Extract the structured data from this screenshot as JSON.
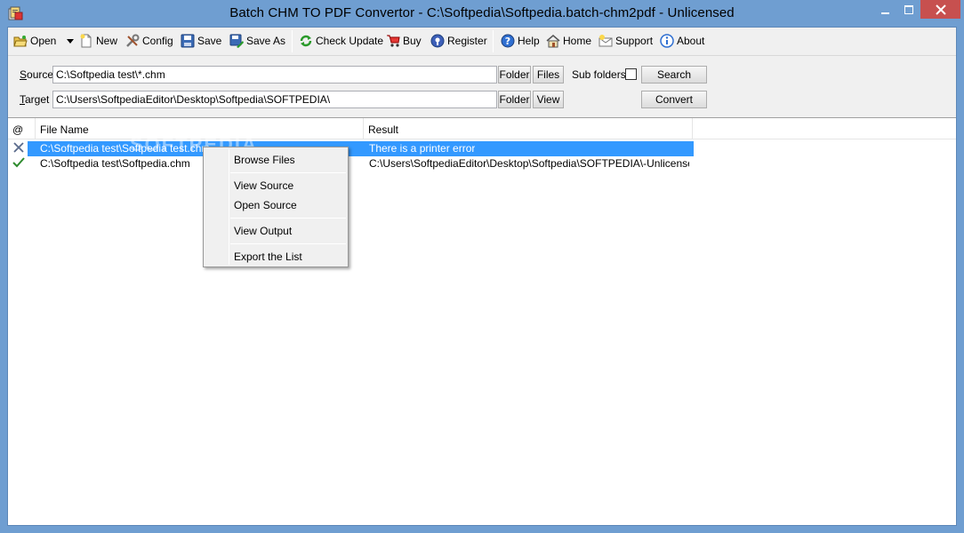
{
  "window": {
    "title": "Batch CHM TO PDF Convertor - C:\\Softpedia\\Softpedia.batch-chm2pdf - Unlicensed"
  },
  "toolbar": {
    "open": "Open",
    "new": "New",
    "config": "Config",
    "save": "Save",
    "save_as": "Save As",
    "check_update": "Check Update",
    "buy": "Buy",
    "register": "Register",
    "help": "Help",
    "home": "Home",
    "support": "Support",
    "about": "About"
  },
  "form": {
    "source_label_key": "S",
    "source_label_rest": "ource",
    "source_value": "C:\\Softpedia test\\*.chm",
    "target_label_key": "T",
    "target_label_rest": "arget",
    "target_value": "C:\\Users\\SoftpediaEditor\\Desktop\\Softpedia\\SOFTPEDIA\\",
    "folder_btn": "Folder",
    "files_btn": "Files",
    "view_btn": "View",
    "subfolders_label": "Sub folders",
    "subfolders_checked": false,
    "search_btn": "Search",
    "convert_btn": "Convert"
  },
  "list": {
    "columns": [
      "@",
      "File Name",
      "Result"
    ],
    "rows": [
      {
        "status_icon": "error-x-icon",
        "file": "C:\\Softpedia test\\Softpedia test.chm",
        "result": "There is a printer error",
        "selected": true
      },
      {
        "status_icon": "check-icon",
        "file": "C:\\Softpedia test\\Softpedia.chm",
        "result": "C:\\Users\\SoftpediaEditor\\Desktop\\Softpedia\\SOFTPEDIA\\-Unlicensed-S...",
        "selected": false
      }
    ]
  },
  "context_menu": {
    "items": [
      "Browse Files",
      "View  Source",
      "Open Source",
      "View  Output",
      "Export the List"
    ]
  },
  "watermark": "SOFTPEDIA",
  "colors": {
    "frame": "#6f9ed1",
    "close": "#c7504f",
    "selection": "#3399ff"
  }
}
